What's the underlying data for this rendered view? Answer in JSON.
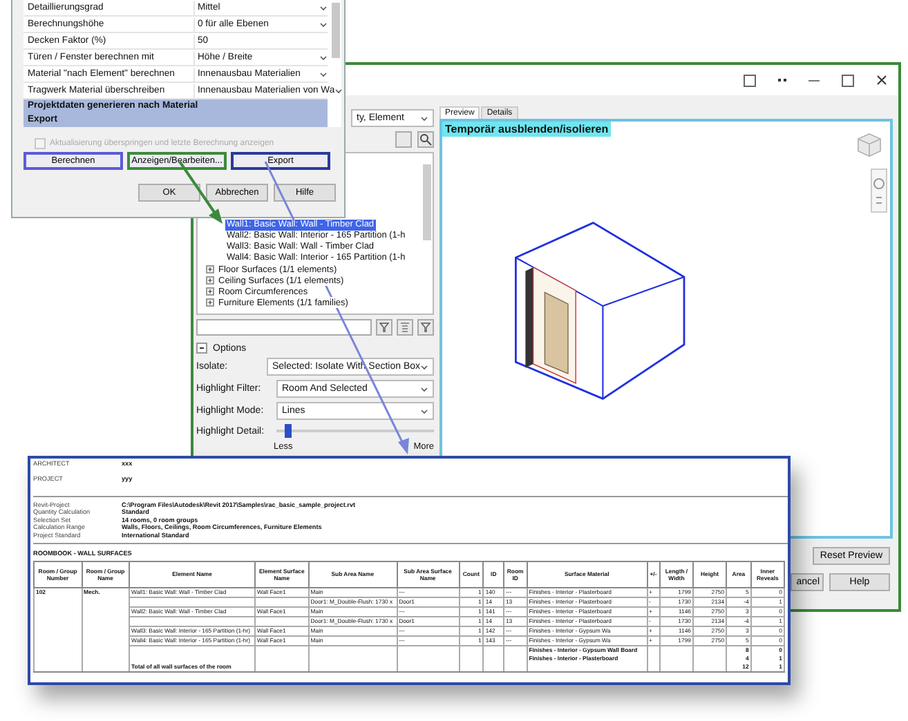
{
  "settings_dialog": {
    "rows": [
      {
        "label": "Detaillierungsgrad",
        "value": "Mittel",
        "kind": "dropdown"
      },
      {
        "label": "Berechnungshöhe",
        "value": "0 für alle Ebenen",
        "kind": "dropdown"
      },
      {
        "label": "Decken Faktor (%)",
        "value": "50",
        "kind": "text"
      },
      {
        "label": "Türen / Fenster berechnen mit",
        "value": "Höhe / Breite",
        "kind": "dropdown"
      },
      {
        "label": "Material \"nach Element\" berechnen",
        "value": "Innenausbau Materialien",
        "kind": "dropdown"
      },
      {
        "label": "Tragwerk Material überschreiben",
        "value": "Innenausbau Materialien von Wa",
        "kind": "dropdown"
      }
    ],
    "sections": [
      "Projektdaten generieren nach Material",
      "Export"
    ],
    "checkbox": {
      "label": "Aktualisierung überspringen und letzte Berechnung anzeigen",
      "checked": false,
      "disabled": true
    },
    "action_buttons": [
      {
        "label": "Berechnen",
        "color": "#5b5bd6"
      },
      {
        "label": "Anzeigen/Bearbeiten...",
        "color": "#3c8a3c"
      },
      {
        "label": "Export",
        "color": "#2a3a9a"
      }
    ],
    "buttons": [
      "OK",
      "Abbrechen",
      "Hilfe"
    ]
  },
  "main_window": {
    "grouping": "ty, Element",
    "wall_items": [
      {
        "label": "Wall1: Basic Wall: Wall - Timber Clad",
        "selected": true
      },
      {
        "label": "Wall2: Basic Wall: Interior - 165 Partition (1-h",
        "selected": false
      },
      {
        "label": "Wall3: Basic Wall: Wall - Timber Clad",
        "selected": false
      },
      {
        "label": "Wall4: Basic Wall: Interior - 165 Partition (1-h",
        "selected": false
      }
    ],
    "categories": [
      {
        "label": "Floor Surfaces (1/1 elements)",
        "expanded": false
      },
      {
        "label": "Ceiling Surfaces (1/1 elements)",
        "expanded": false
      },
      {
        "label": "Room Circumferences",
        "expanded": false
      },
      {
        "label": "Furniture Elements (1/1 families)",
        "expanded": false
      }
    ],
    "options_label": "Options",
    "fields": [
      {
        "label": "Isolate:",
        "value": "Selected: Isolate With Section Box"
      },
      {
        "label": "Highlight Filter:",
        "value": "Room And Selected"
      },
      {
        "label": "Highlight Mode:",
        "value": "Lines"
      }
    ],
    "highlight_detail": {
      "label": "Highlight Detail:",
      "level": 0.05,
      "min_label": "Less",
      "max_label": "More"
    },
    "tabs": [
      {
        "label": "Preview",
        "selected": true
      },
      {
        "label": "Details",
        "selected": false
      }
    ],
    "preview_title": "Temporär ausblenden/isolieren",
    "reset_button": "Reset Preview",
    "buttons": [
      "ancel",
      "Help"
    ]
  },
  "report": {
    "header": [
      {
        "label": "ARCHITECT",
        "value": "xxx"
      },
      {
        "label": "PROJECT",
        "value": "yyy"
      }
    ],
    "info": [
      {
        "label": "Revit-Project",
        "value": "C:\\Program Files\\Autodesk\\Revit 2017\\Samples\\rac_basic_sample_project.rvt"
      },
      {
        "label": "Quantity Calculation",
        "value": "Standard"
      },
      {
        "label": "Selection Set",
        "value": "14 rooms, 0 room groups"
      },
      {
        "label": "Calculation Range",
        "value": "Walls, Floors, Ceilings, Room Circumferences, Furniture Elements"
      },
      {
        "label": "Project Standard",
        "value": "International Standard"
      }
    ],
    "section_title": "ROOMBOOK - WALL SURFACES",
    "table": {
      "columns": [
        "Room / Group Number",
        "Room / Group Name",
        "Element Name",
        "Element Surface Name",
        "Sub Area Name",
        "Sub Area Surface Name",
        "Count",
        "ID",
        "Room ID",
        "Surface Material",
        "+/-",
        "Length / Width",
        "Height",
        "Area",
        "Inner Reveals"
      ],
      "rows": [
        {
          "kind": "item",
          "cells": [
            "102",
            "Mech.",
            "Wall1: Basic Wall: Wall - Timber Clad",
            "Wall Face1",
            "Main",
            "---",
            "1",
            "140",
            "---",
            "Finishes - Interior - Plasterboard",
            "+",
            "1799",
            "2750",
            "5",
            "0"
          ]
        },
        {
          "kind": "item",
          "cells": [
            "",
            "",
            "",
            "",
            "Door1: M_Double-Flush: 1730 x",
            "Door1",
            "1",
            "14",
            "13",
            "Finishes - Interior - Plasterboard",
            "-",
            "1730",
            "2134",
            "-4",
            "1"
          ]
        },
        {
          "kind": "item",
          "cells": [
            "",
            "",
            "Wall2: Basic Wall: Wall - Timber Clad",
            "Wall Face1",
            "Main",
            "---",
            "1",
            "141",
            "---",
            "Finishes - Interior - Plasterboard",
            "+",
            "1146",
            "2750",
            "3",
            "0"
          ]
        },
        {
          "kind": "item",
          "cells": [
            "",
            "",
            "",
            "",
            "Door1: M_Double-Flush: 1730 x",
            "Door1",
            "1",
            "14",
            "13",
            "Finishes - Interior - Plasterboard",
            "-",
            "1730",
            "2134",
            "-4",
            "1"
          ]
        },
        {
          "kind": "item",
          "cells": [
            "",
            "",
            "Wall3: Basic Wall: Interior - 165 Partition (1-hr)",
            "Wall Face1",
            "Main",
            "---",
            "1",
            "142",
            "---",
            "Finishes - Interior - Gypsum Wa",
            "+",
            "1146",
            "2750",
            "3",
            "0"
          ]
        },
        {
          "kind": "item",
          "cells": [
            "",
            "",
            "Wall4: Basic Wall: Interior - 165 Partition (1-hr)",
            "Wall Face1",
            "Main",
            "---",
            "1",
            "143",
            "---",
            "Finishes - Interior - Gypsum Wa",
            "+",
            "1799",
            "2750",
            "5",
            "0"
          ]
        },
        {
          "kind": "summary",
          "cells": [
            "",
            "",
            "",
            "",
            "",
            "",
            "",
            "",
            "",
            "Finishes - Interior - Gypsum Wall Board",
            "",
            "",
            "",
            "8",
            "0"
          ]
        },
        {
          "kind": "summary",
          "cells": [
            "",
            "",
            "",
            "",
            "",
            "",
            "",
            "",
            "",
            "Finishes - Interior - Plasterboard",
            "",
            "",
            "",
            "4",
            "1"
          ]
        },
        {
          "kind": "total",
          "cells": [
            "",
            "",
            "Total of all wall surfaces of the room",
            "",
            "",
            "",
            "",
            "",
            "",
            "",
            "",
            "",
            "",
            "12",
            "1"
          ]
        }
      ]
    }
  }
}
